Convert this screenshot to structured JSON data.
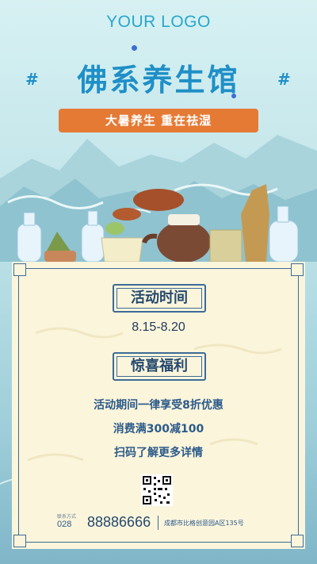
{
  "header": {
    "logo_text": "YOUR LOGO",
    "hash_left": "#",
    "hash_right": "#"
  },
  "title": {
    "main": "佛系养生馆",
    "subtitle": "大暑养生 重在祛湿"
  },
  "card": {
    "event_label": "活动时间",
    "event_dates": "8.15-8.20",
    "benefit_label": "惊喜福利",
    "benefit_lines": [
      "活动期间一律享受8折优惠",
      "消费满300减100",
      "扫码了解更多详情"
    ]
  },
  "footer": {
    "contact_label": "联系方式",
    "area_code": "028",
    "phone": "88886666",
    "address": "成都市比格创意园A区135号"
  },
  "colors": {
    "accent_blue": "#1f8fc7",
    "accent_orange": "#e57a35",
    "card_bg": "#fbf5dc",
    "frame_blue": "#3d6b96"
  }
}
